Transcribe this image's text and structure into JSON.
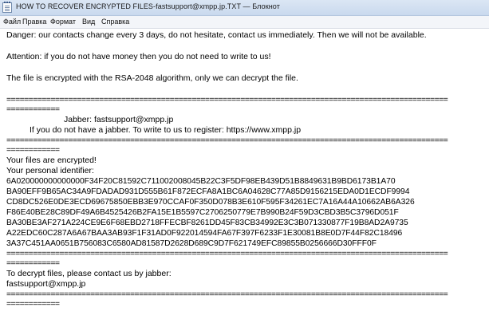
{
  "window": {
    "title": "HOW TO RECOVER ENCRYPTED FILES-fastsupport@xmpp.jp.TXT — Блокнот",
    "icon": "notepad-icon"
  },
  "menu": {
    "file": "Файл",
    "edit": "Правка",
    "format": "Формат",
    "view": "Вид",
    "help": "Справка"
  },
  "document": {
    "danger": "Danger: our contacts change every 3 days, do not hesitate, contact us immediately. Then we will not be available.",
    "attention": "Attention: if you do not have money then you do not need to write to us!",
    "rsa": "The file is encrypted with the RSA-2048 algorithm, only we can decrypt the file.",
    "separator_long": "====================================================================================================",
    "separator_short": "============",
    "jabber": "Jabber: fastsupport@xmpp.jp",
    "register": "If you do not have a jabber. To write to us to register: https://www.xmpp.jp",
    "files_encrypted": "Your files are encrypted!",
    "personal_id_label": "Your personal identifier:",
    "identifier_lines": [
      "6A020000000000000F34F20C81592C711002008045B22C3F5DF98EB439D51B8849631B9BD6173B1A70",
      "BA90EFF9B65AC34A9FDADAD931D555B61F872ECFA8A1BC6A04628C77A85D9156215EDA0D1ECDF9994",
      "CD8DC526E0DE3ECD69675850EBB3E970CCAF0F350D078B3E610F595F34261EC7A16A44A10662AB6A326",
      "F86E40BE28C89DF49A6B4525426B2FA15E1B5597C2706250779E7B990B24F59D3CBD3B5C3796D051F",
      "BA30BE3AF271A224CE9E6F68EBD2718FFECBF8261DD45F83CB34992E3C3B071330877F19B8AD2A9735",
      "A22EDC60C287A6A67BAA3AB93F1F31AD0F922014594FA67F397F6233F1E30081B8E0D7F44F82C18496",
      "3A37C451AA0651B756083C6580AD81587D2628D689C9D7F621749EFC89855B0256666D30FFF0F"
    ],
    "decrypt_instruction": "To decrypt files, please contact us by jabber:",
    "contact": "fastsupport@xmpp.jp"
  }
}
